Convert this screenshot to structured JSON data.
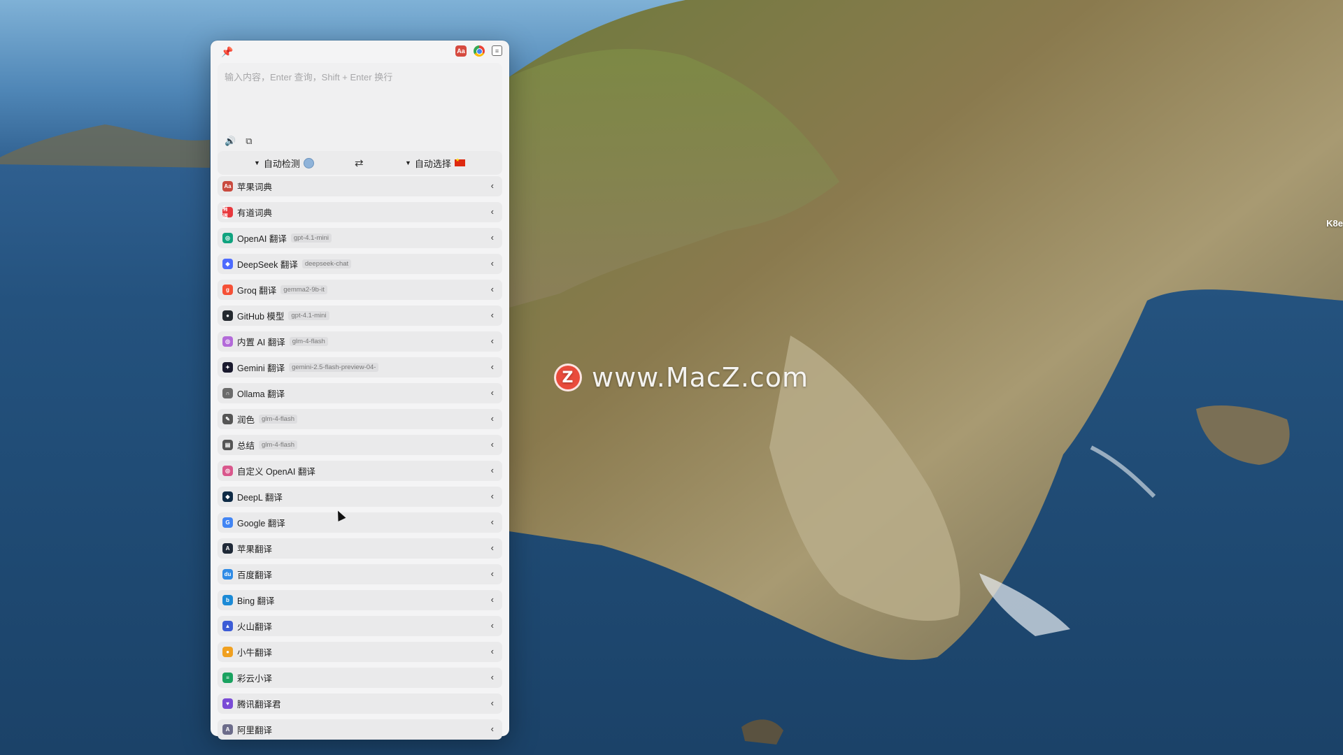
{
  "watermark": {
    "logo_letter": "Z",
    "text": "www.MacZ.com"
  },
  "edge_text": "K8e",
  "window": {
    "top_icons": {
      "dict_icon": "dictionary-icon",
      "chrome_icon": "chrome-icon",
      "settings_icon": "settings-toggle-icon",
      "dict_label": "Aa"
    },
    "input": {
      "placeholder": "输入内容，Enter 查询，Shift + Enter 换行",
      "value": ""
    },
    "language_bar": {
      "source": "自动检测",
      "target": "自动选择",
      "swap_symbol": "⇄"
    },
    "services": [
      {
        "name": "苹果词典",
        "model": "",
        "color": "#c94a3f",
        "glyph": "Aa"
      },
      {
        "name": "有道词典",
        "model": "",
        "color": "#e8383d",
        "glyph": "有道"
      },
      {
        "name": "OpenAI 翻译",
        "model": "gpt-4.1-mini",
        "color": "#10a37f",
        "glyph": "◎"
      },
      {
        "name": "DeepSeek 翻译",
        "model": "deepseek-chat",
        "color": "#4d6bfe",
        "glyph": "◆"
      },
      {
        "name": "Groq 翻译",
        "model": "gemma2-9b-it",
        "color": "#f55036",
        "glyph": "g"
      },
      {
        "name": "GitHub 模型",
        "model": "gpt-4.1-mini",
        "color": "#24292f",
        "glyph": "●"
      },
      {
        "name": "内置 AI 翻译",
        "model": "glm-4-flash",
        "color": "#b36ad9",
        "glyph": "◎"
      },
      {
        "name": "Gemini 翻译",
        "model": "gemini-2.5-flash-preview-04-",
        "color": "#1a1a2e",
        "glyph": "✦"
      },
      {
        "name": "Ollama 翻译",
        "model": "",
        "color": "#6b6b6b",
        "glyph": "∩"
      },
      {
        "name": "润色",
        "model": "glm-4-flash",
        "color": "#555555",
        "glyph": "✎"
      },
      {
        "name": "总结",
        "model": "glm-4-flash",
        "color": "#555555",
        "glyph": "▤"
      },
      {
        "name": "自定义 OpenAI 翻译",
        "model": "",
        "color": "#d9578c",
        "glyph": "◎"
      },
      {
        "name": "DeepL 翻译",
        "model": "",
        "color": "#0f2b46",
        "glyph": "◆"
      },
      {
        "name": "Google 翻译",
        "model": "",
        "color": "#4285f4",
        "glyph": "G"
      },
      {
        "name": "苹果翻译",
        "model": "",
        "color": "#1f2937",
        "glyph": "A"
      },
      {
        "name": "百度翻译",
        "model": "",
        "color": "#2f8be6",
        "glyph": "du"
      },
      {
        "name": "Bing 翻译",
        "model": "",
        "color": "#1b8ad6",
        "glyph": "b"
      },
      {
        "name": "火山翻译",
        "model": "",
        "color": "#3c5cd6",
        "glyph": "▲"
      },
      {
        "name": "小牛翻译",
        "model": "",
        "color": "#f0a020",
        "glyph": "●"
      },
      {
        "name": "彩云小译",
        "model": "",
        "color": "#1aa260",
        "glyph": "≡"
      },
      {
        "name": "腾讯翻译君",
        "model": "",
        "color": "#7a4bd6",
        "glyph": "♥"
      },
      {
        "name": "阿里翻译",
        "model": "",
        "color": "#6c6c8a",
        "glyph": "A"
      }
    ]
  }
}
